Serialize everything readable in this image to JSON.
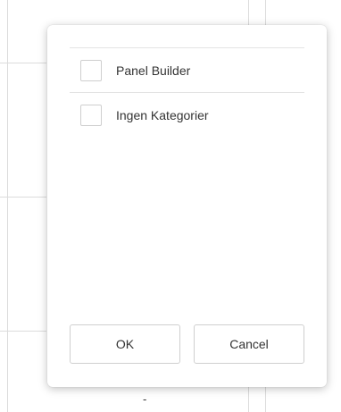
{
  "background": {
    "cell_top": "",
    "cell_bottom": "-"
  },
  "dialog": {
    "items": [
      {
        "label": "Panel Builder",
        "checked": false
      },
      {
        "label": "Ingen Kategorier",
        "checked": false
      }
    ],
    "ok_label": "OK",
    "cancel_label": "Cancel"
  }
}
